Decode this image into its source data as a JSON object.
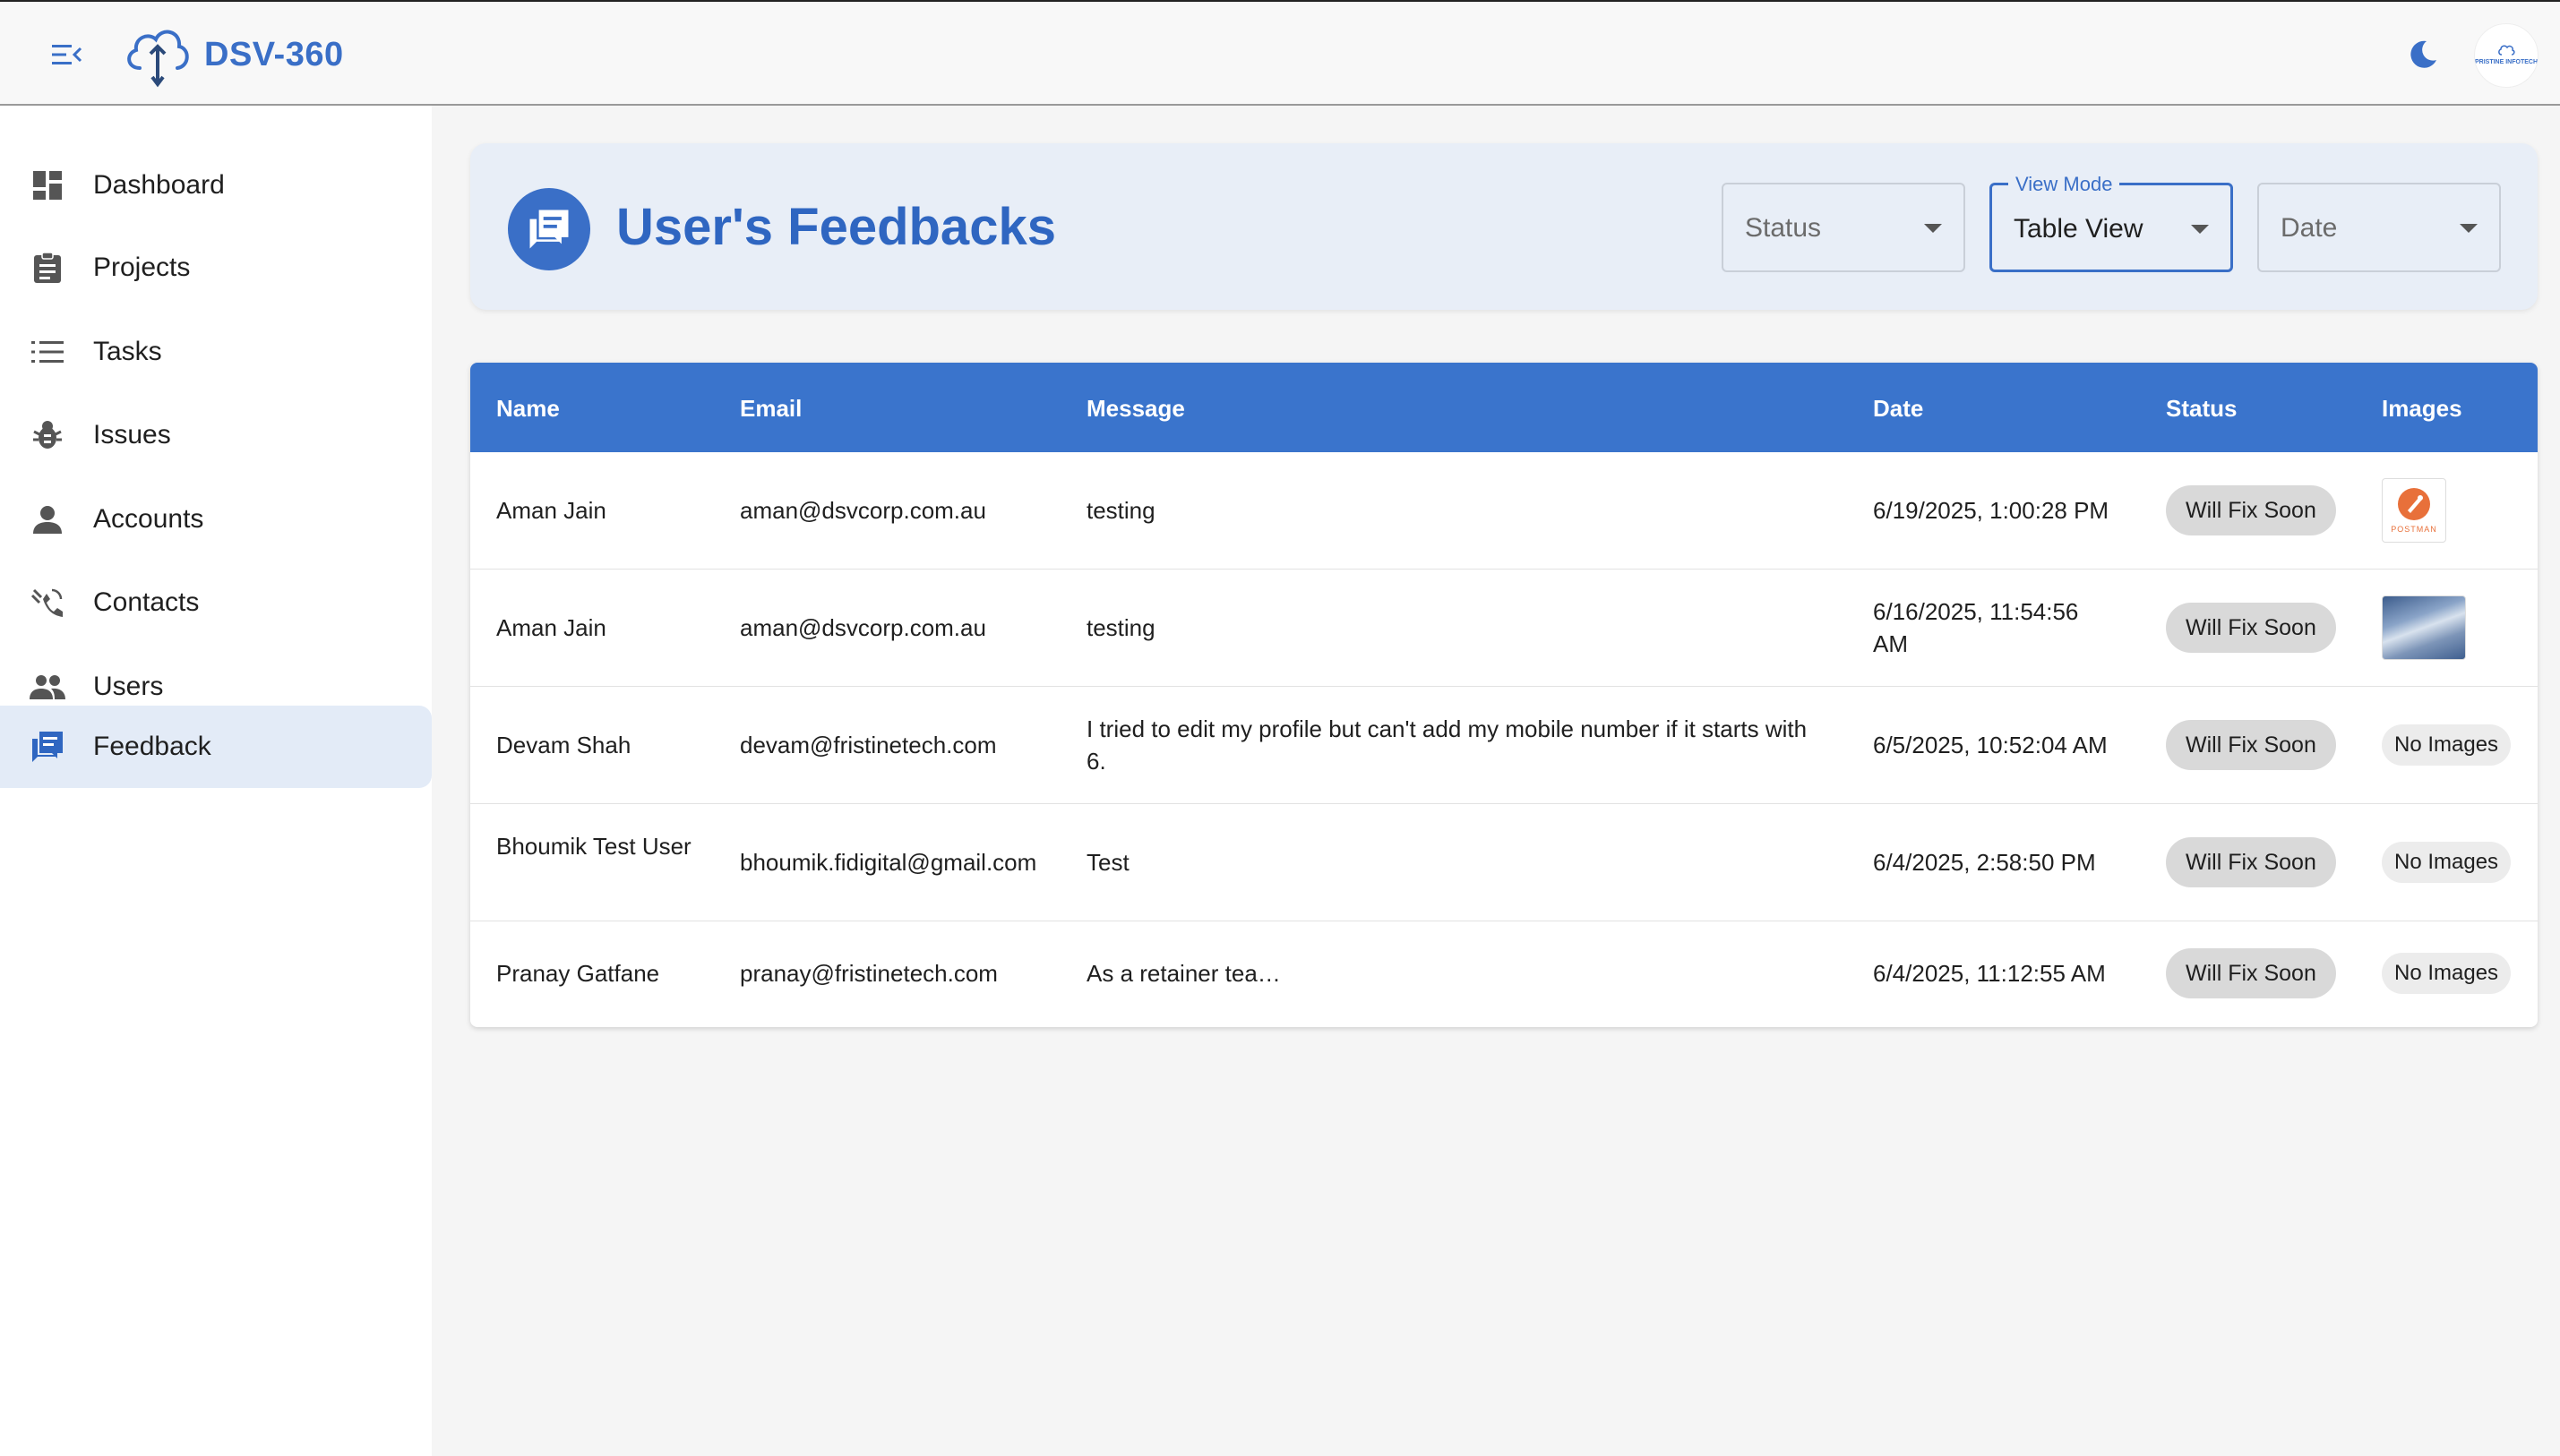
{
  "app": {
    "name": "DSV-360",
    "avatar_text": "PRISTINE INFOTECH"
  },
  "sidebar": {
    "items": [
      {
        "label": "Dashboard",
        "icon": "dashboard-icon"
      },
      {
        "label": "Projects",
        "icon": "clipboard-icon"
      },
      {
        "label": "Tasks",
        "icon": "list-icon"
      },
      {
        "label": "Issues",
        "icon": "bug-icon"
      },
      {
        "label": "Accounts",
        "icon": "person-icon"
      },
      {
        "label": "Contacts",
        "icon": "contacts-icon"
      },
      {
        "label": "Users",
        "icon": "people-icon"
      },
      {
        "label": "Feedback",
        "icon": "feedback-icon",
        "active": true
      }
    ]
  },
  "header": {
    "title": "User's Feedbacks",
    "filters": {
      "status": {
        "placeholder": "Status"
      },
      "view_mode": {
        "label": "View Mode",
        "value": "Table View"
      },
      "date": {
        "placeholder": "Date"
      }
    }
  },
  "table": {
    "columns": [
      "Name",
      "Email",
      "Message",
      "Date",
      "Status",
      "Images"
    ],
    "rows": [
      {
        "name": "Aman Jain",
        "email": "aman@dsvcorp.com.au",
        "message": "testing",
        "date": "6/19/2025, 1:00:28 PM",
        "status": "Will Fix Soon",
        "image": "postman-thumbnail"
      },
      {
        "name": "Aman Jain",
        "email": "aman@dsvcorp.com.au",
        "message": "testing",
        "date": "6/16/2025, 11:54:56 AM",
        "status": "Will Fix Soon",
        "image": "clouds-thumbnail"
      },
      {
        "name": "Devam Shah",
        "email": "devam@fristinetech.com",
        "message": "I tried to edit my profile but can't add my mobile number if it starts with 6.",
        "date": "6/5/2025, 10:52:04 AM",
        "status": "Will Fix Soon",
        "image": "No Images"
      },
      {
        "name": "Bhoumik Test User",
        "email": "bhoumik.fidigital@gmail.com",
        "message": "Test",
        "date": "6/4/2025, 2:58:50 PM",
        "status": "Will Fix Soon",
        "image": "No Images"
      },
      {
        "name": "Pranay Gatfane",
        "email": "pranay@fristinetech.com",
        "message": "As a retainer tea…",
        "date": "6/4/2025, 11:12:55 AM",
        "status": "Will Fix Soon",
        "image": "No Images"
      }
    ],
    "postman_label": "POSTMAN"
  },
  "colors": {
    "accent": "#3a6fc7",
    "header_bg": "#3a74cc",
    "active_nav_bg": "#e3ebf7"
  }
}
